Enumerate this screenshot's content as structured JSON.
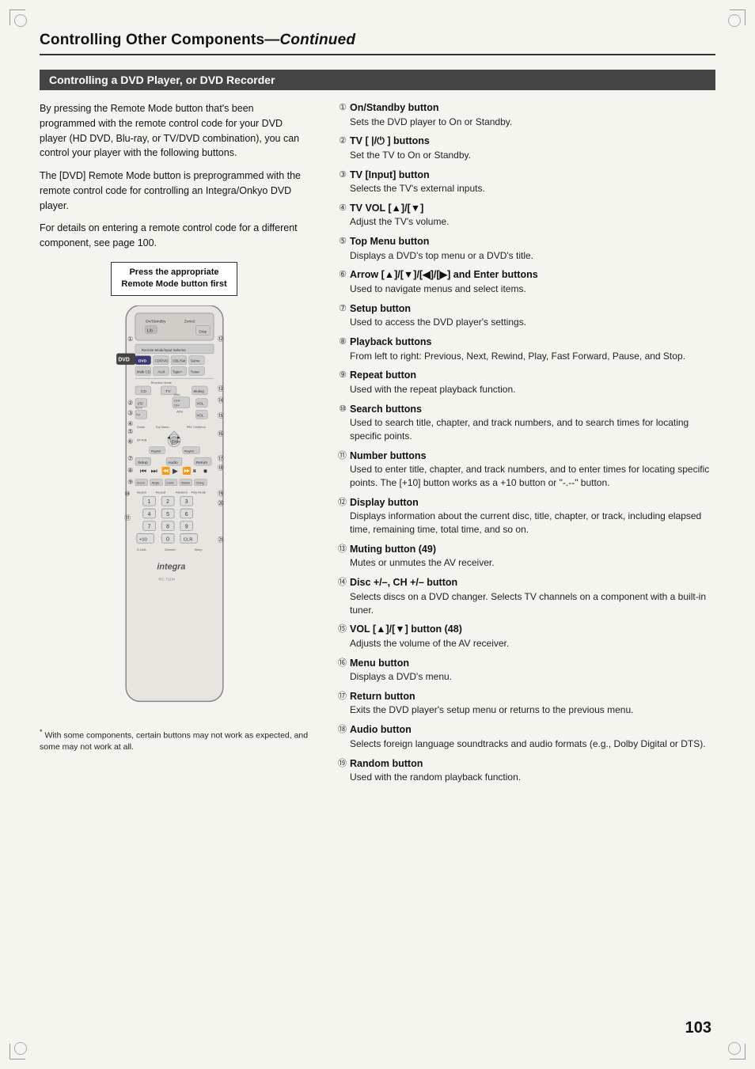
{
  "page": {
    "title_normal": "Controlling Other Components",
    "title_italic": "—Continued",
    "page_number": "103"
  },
  "section": {
    "title": "Controlling a DVD Player, or DVD Recorder"
  },
  "left_col": {
    "paragraphs": [
      "By pressing the Remote Mode button that's been programmed with the remote control code for your DVD player (HD DVD, Blu-ray, or TV/DVD combination), you can control your player with the following buttons.",
      "The [DVD] Remote Mode button is preprogrammed with the remote control code for controlling an Integra/Onkyo DVD player.",
      "For details on entering a remote control code for a different component, see page 100."
    ],
    "callout": "Press the appropriate Remote Mode button first",
    "footnote_star": "*",
    "footnote_text": "With some components, certain buttons may not work as expected, and some may not work at all."
  },
  "right_col": {
    "items": [
      {
        "num": "①",
        "title": "On/Standby button",
        "desc": "Sets the DVD player to On or Standby."
      },
      {
        "num": "②",
        "title": "TV [ |/⏻ ] buttons",
        "desc": "Set the TV to On or Standby."
      },
      {
        "num": "③",
        "title": "TV [Input] button",
        "desc": "Selects the TV's external inputs."
      },
      {
        "num": "④",
        "title": "TV VOL [▲]/[▼]",
        "desc": "Adjust the TV's volume."
      },
      {
        "num": "⑤",
        "title": "Top Menu button",
        "desc": "Displays a DVD's top menu or a DVD's title."
      },
      {
        "num": "⑥",
        "title": "Arrow [▲]/[▼]/[◀]/[▶] and Enter buttons",
        "desc": "Used to navigate menus and select items."
      },
      {
        "num": "⑦",
        "title": "Setup button",
        "desc": "Used to access the DVD player's settings."
      },
      {
        "num": "⑧",
        "title": "Playback buttons",
        "desc": "From left to right: Previous, Next, Rewind, Play, Fast Forward, Pause, and Stop."
      },
      {
        "num": "⑨",
        "title": "Repeat button",
        "desc": "Used with the repeat playback function."
      },
      {
        "num": "⑩",
        "title": "Search buttons",
        "desc": "Used to search title, chapter, and track numbers, and to search times for locating specific points."
      },
      {
        "num": "⑪",
        "title": "Number buttons",
        "desc": "Used to enter title, chapter, and track numbers, and to enter times for locating specific points. The [+10] button works as a +10 button or \"-.--\" button."
      },
      {
        "num": "⑫",
        "title": "Display button",
        "desc": "Displays information about the current disc, title, chapter, or track, including elapsed time, remaining time, total time, and so on."
      },
      {
        "num": "⑬",
        "title": "Muting button (49)",
        "desc": "Mutes or unmutes the AV receiver."
      },
      {
        "num": "⑭",
        "title": "Disc +/–, CH +/– button",
        "desc": "Selects discs on a DVD changer. Selects TV channels on a component with a built-in tuner."
      },
      {
        "num": "⑮",
        "title": "VOL [▲]/[▼] button (48)",
        "desc": "Adjusts the volume of the AV receiver."
      },
      {
        "num": "⑯",
        "title": "Menu button",
        "desc": "Displays a DVD's menu."
      },
      {
        "num": "⑰",
        "title": "Return button",
        "desc": "Exits the DVD player's setup menu or returns to the previous menu."
      },
      {
        "num": "⑱",
        "title": "Audio button",
        "desc": "Selects foreign language soundtracks and audio formats (e.g., Dolby Digital or DTS)."
      },
      {
        "num": "⑲",
        "title": "Random button",
        "desc": "Used with the random playback function."
      }
    ]
  }
}
